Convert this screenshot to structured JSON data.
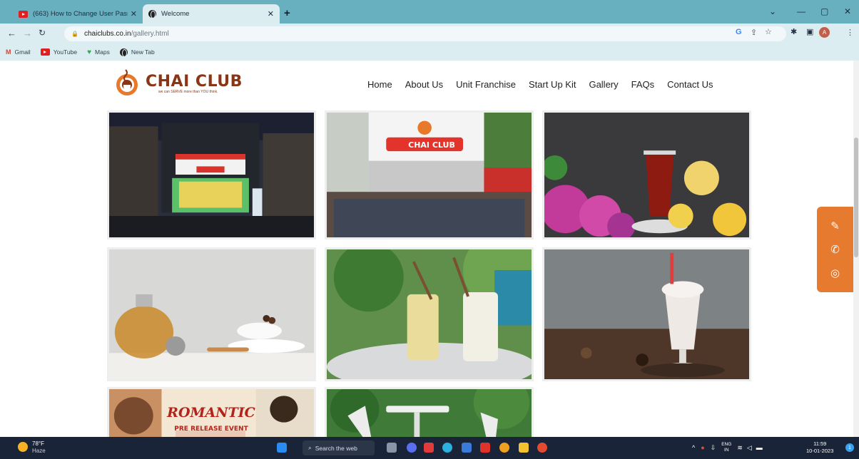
{
  "browser": {
    "tabs": [
      {
        "title": "(663) How to Change User Passw",
        "icon": "youtube-icon",
        "active": false
      },
      {
        "title": "Welcome",
        "icon": "globe-icon",
        "active": true
      }
    ],
    "url_host": "chaiclubs.co.in",
    "url_path": "/gallery.html",
    "bookmarks": [
      {
        "label": "Gmail",
        "icon": "gmail-icon"
      },
      {
        "label": "YouTube",
        "icon": "youtube-icon"
      },
      {
        "label": "Maps",
        "icon": "maps-icon"
      },
      {
        "label": "New Tab",
        "icon": "globe-icon"
      }
    ],
    "avatar_letter": "A"
  },
  "site": {
    "brand": "CHAI CLUB",
    "tagline": "we can SERVE more than YOU think.",
    "nav": [
      "Home",
      "About Us",
      "Unit Franchise",
      "Start Up Kit",
      "Gallery",
      "FAQs",
      "Contact Us"
    ],
    "gallery": [
      {
        "subject": "storefront-night"
      },
      {
        "subject": "storefront-team"
      },
      {
        "subject": "tea-glass-flowers"
      },
      {
        "subject": "teapot-cups"
      },
      {
        "subject": "iced-drinks"
      },
      {
        "subject": "chocolate-shake"
      },
      {
        "subject": "romantic-poster"
      },
      {
        "subject": "outdoor-cafe"
      }
    ],
    "poster": {
      "title": "ROMANTIC",
      "subtitle": "PRE RELEASE EVENT"
    },
    "storefront_sign": "CHAI CLUB",
    "float_icons": [
      "edit-icon",
      "phone-icon",
      "whatsapp-icon"
    ]
  },
  "taskbar": {
    "temp": "78°F",
    "condition": "Haze",
    "search": "Search the web",
    "lang_line1": "ENG",
    "lang_line2": "IN",
    "time": "11:59",
    "date": "10-01-2023",
    "notifications": "1"
  }
}
